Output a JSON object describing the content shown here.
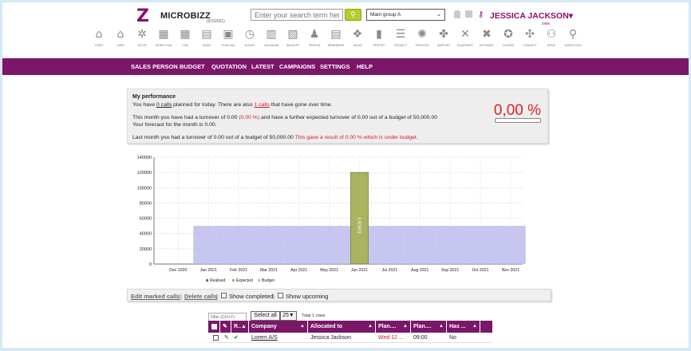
{
  "app": {
    "logo_mark": "Z",
    "name": "MICROBIZZ",
    "date_tag": "(0/1/2021)"
  },
  "header": {
    "search_placeholder": "Enter your search term here",
    "search_button_icon": "search-icon",
    "group_select_value": "Main group A",
    "user_name": "JESSICA JACKSON▾",
    "user_sub": "2896"
  },
  "toolbar": [
    {
      "label": "START",
      "icon": "home-icon",
      "glyph": "⌂"
    },
    {
      "label": "USER",
      "icon": "building-icon",
      "glyph": "⌂"
    },
    {
      "label": "SETUP",
      "icon": "gear-icon",
      "glyph": "✲"
    },
    {
      "label": "WORK PLAN",
      "icon": "calendar-icon",
      "glyph": "▦"
    },
    {
      "label": "CSM",
      "icon": "grid-icon",
      "glyph": "▦"
    },
    {
      "label": "TASKS",
      "icon": "clipboard-icon",
      "glyph": "▤"
    },
    {
      "label": "PLAN HUD",
      "icon": "layout-icon",
      "glyph": "▣"
    },
    {
      "label": "HOURS",
      "icon": "clock-icon",
      "glyph": "◷"
    },
    {
      "label": "CALENDAR",
      "icon": "calendar-icon",
      "glyph": "▥"
    },
    {
      "label": "INVOICES",
      "icon": "printer-icon",
      "glyph": "▧"
    },
    {
      "label": "PERSON",
      "icon": "person-icon",
      "glyph": "♟"
    },
    {
      "label": "REMINDERS",
      "icon": "document-icon",
      "glyph": "▤"
    },
    {
      "label": "SALES",
      "icon": "handshake-icon",
      "glyph": "❖"
    },
    {
      "label": "REPORT",
      "icon": "bar-chart-icon",
      "glyph": "▮"
    },
    {
      "label": "PROJECT",
      "icon": "list-icon",
      "glyph": "☰"
    },
    {
      "label": "PROCESS",
      "icon": "spinner-icon",
      "glyph": "✺"
    },
    {
      "label": "SUPPORT",
      "icon": "tools-icon",
      "glyph": "✤"
    },
    {
      "label": "EQUIPMENT",
      "icon": "wrench-icon",
      "glyph": "✕"
    },
    {
      "label": "EXTRANET",
      "icon": "cross-tools-icon",
      "glyph": "✖"
    },
    {
      "label": "COURSE",
      "icon": "award-icon",
      "glyph": "✪"
    },
    {
      "label": "CONNECT",
      "icon": "network-icon",
      "glyph": "✣"
    },
    {
      "label": "DRIVE",
      "icon": "car-icon",
      "glyph": "⚇"
    },
    {
      "label": "INSPECTION",
      "icon": "magnifier-icon",
      "glyph": "⚲"
    }
  ],
  "menu": [
    "SALES PERSON",
    "BUDGET",
    "QUOTATION",
    "LATEST",
    "CAMPAIGNS",
    "SETTINGS",
    "HELP"
  ],
  "performance": {
    "heading": "My performance",
    "l1_a": "You have ",
    "l1_calls": "0 calls",
    "l1_b": " planned for today. There are also ",
    "l1_calls2": "1 calls",
    "l1_c": " that have gone over time.",
    "l2_a": "This month you have had a turnover of 0.00 ",
    "l2_pct": "(0.00 %)",
    "l2_b": " and have a further expected turnover of 0.00 out of a budget of 50,000.00",
    "l3": "Your forecast for the month is 0.00.",
    "l4_a": "Last month you had a turnover of 0.00 out of a budget of 50,000.00 ",
    "l4_red": "This gave a result of 0.00 % which is under budget.",
    "percent_display": "0,00 %",
    "progress": 0,
    "accent": "#e02020"
  },
  "chart_data": {
    "type": "bar",
    "categories": [
      "Dec 2020",
      "Jan 2021",
      "Feb 2021",
      "Mar 2021",
      "Apr 2021",
      "May 2021",
      "Jun 2021",
      "Jul 2021",
      "Aug 2021",
      "Sep 2021",
      "Oct 2021",
      "Nov 2021"
    ],
    "series": [
      {
        "name": "Realised",
        "values": [
          0,
          0,
          0,
          0,
          0,
          0,
          0,
          0,
          0,
          0,
          0,
          0
        ],
        "color": "#3f8f3f"
      },
      {
        "name": "Expected",
        "values": [
          0,
          0,
          0,
          0,
          0,
          0,
          120000,
          0,
          0,
          0,
          0,
          0
        ],
        "color": "#a9b360"
      },
      {
        "name": "Budget",
        "values": [
          0,
          50000,
          50000,
          50000,
          50000,
          50000,
          50000,
          50000,
          50000,
          50000,
          50000,
          50000
        ],
        "color": "#b8b8ec"
      }
    ],
    "bar_label": "119618.5",
    "yticks": [
      0,
      20000,
      40000,
      60000,
      80000,
      100000,
      120000,
      140000
    ],
    "ylim": [
      0,
      140000
    ],
    "grid": true,
    "legend_position": "bottom"
  },
  "calls_bar": {
    "edit": "Edit marked calls",
    "sep1": "|",
    "delete": "Delete calls",
    "sep2": "|",
    "show_completed": "Show completed",
    "sep3": "|",
    "show_upcoming": "Show upcoming"
  },
  "list": {
    "filter_placeholder": "Filter (Ctrl+Y)",
    "select_all": "Select all",
    "page_size": "25▼",
    "total": "Total 1 rows",
    "columns": [
      {
        "label": "",
        "kind": "checkbox"
      },
      {
        "label": "✎",
        "kind": "icon"
      },
      {
        "label": "R..▲",
        "kind": "text"
      },
      {
        "label": "Company",
        "kind": "text"
      },
      {
        "label": "Allocated to",
        "kind": "text"
      },
      {
        "label": "Plan....",
        "kind": "text"
      },
      {
        "label": "Plan....",
        "kind": "text"
      },
      {
        "label": "Has ...",
        "kind": "text"
      },
      {
        "label": "",
        "kind": "text"
      }
    ],
    "rows": [
      {
        "edit": "✎",
        "status": "✔",
        "company": "Lorem A/S",
        "allocated": "Jessica Jackson",
        "plan_date": "Wed 12 ...",
        "plan_time": "09:00",
        "has": "No"
      }
    ]
  }
}
